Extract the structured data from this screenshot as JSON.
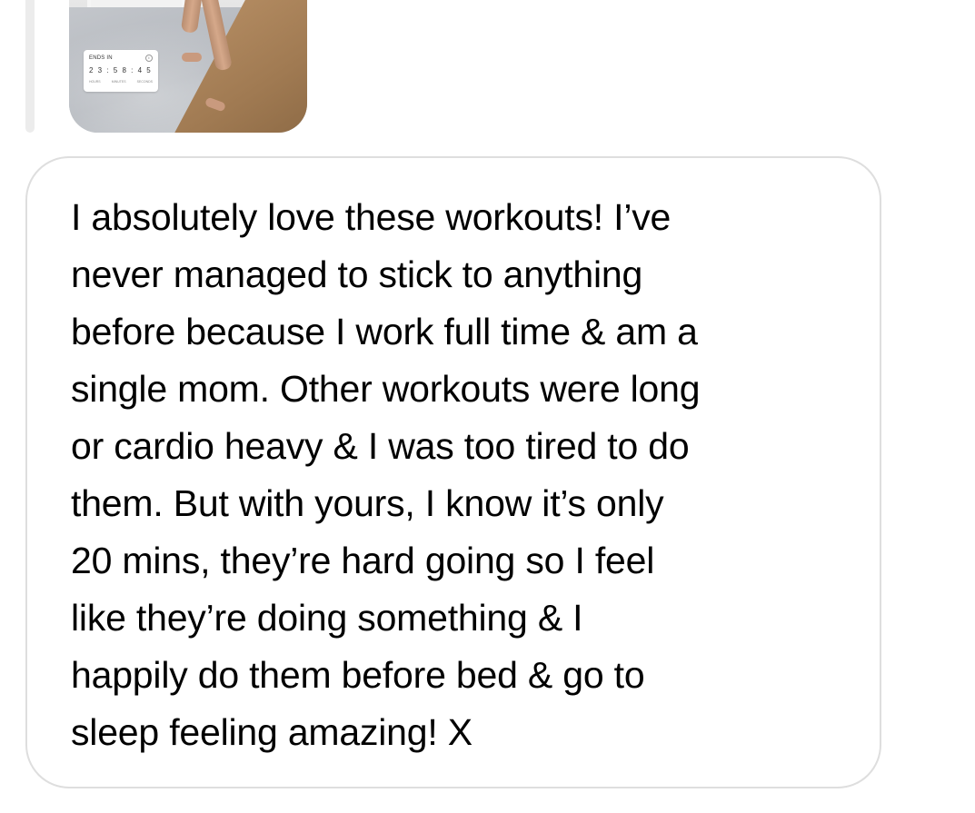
{
  "story_preview": {
    "timer_label": "ENDS IN",
    "timer_value": "2 3 : 5 8 : 4 5",
    "timer_units": [
      "HOURS",
      "MINUTES",
      "SECONDS"
    ]
  },
  "message": {
    "text": "I absolutely love these workouts! I’ve\nnever managed to stick to anything\nbefore because I work full time & am a\nsingle mom. Other workouts were long\nor cardio heavy & I was too tired to do\nthem. But with yours, I know it’s only\n20 mins, they’re hard going so I feel\nlike they’re doing something & I\nhappily do them before bed & go to\nsleep feeling amazing! X"
  }
}
